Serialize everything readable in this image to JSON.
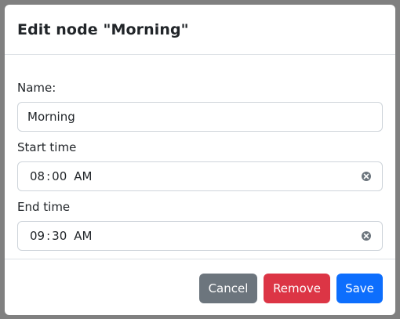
{
  "dialog": {
    "title": "Edit node \"Morning\""
  },
  "form": {
    "name": {
      "label": "Name:",
      "value": "Morning"
    },
    "start_time": {
      "label": "Start time",
      "hours": "08",
      "minutes": "00",
      "ampm": "AM"
    },
    "end_time": {
      "label": "End time",
      "hours": "09",
      "minutes": "30",
      "ampm": "AM"
    }
  },
  "footer": {
    "cancel_label": "Cancel",
    "remove_label": "Remove",
    "save_label": "Save"
  },
  "colors": {
    "cancel": "#6c757d",
    "remove": "#dc3545",
    "save": "#0d6efd",
    "backdrop": "#808080"
  },
  "icons": {
    "clear": "clear-circle-x-icon"
  }
}
